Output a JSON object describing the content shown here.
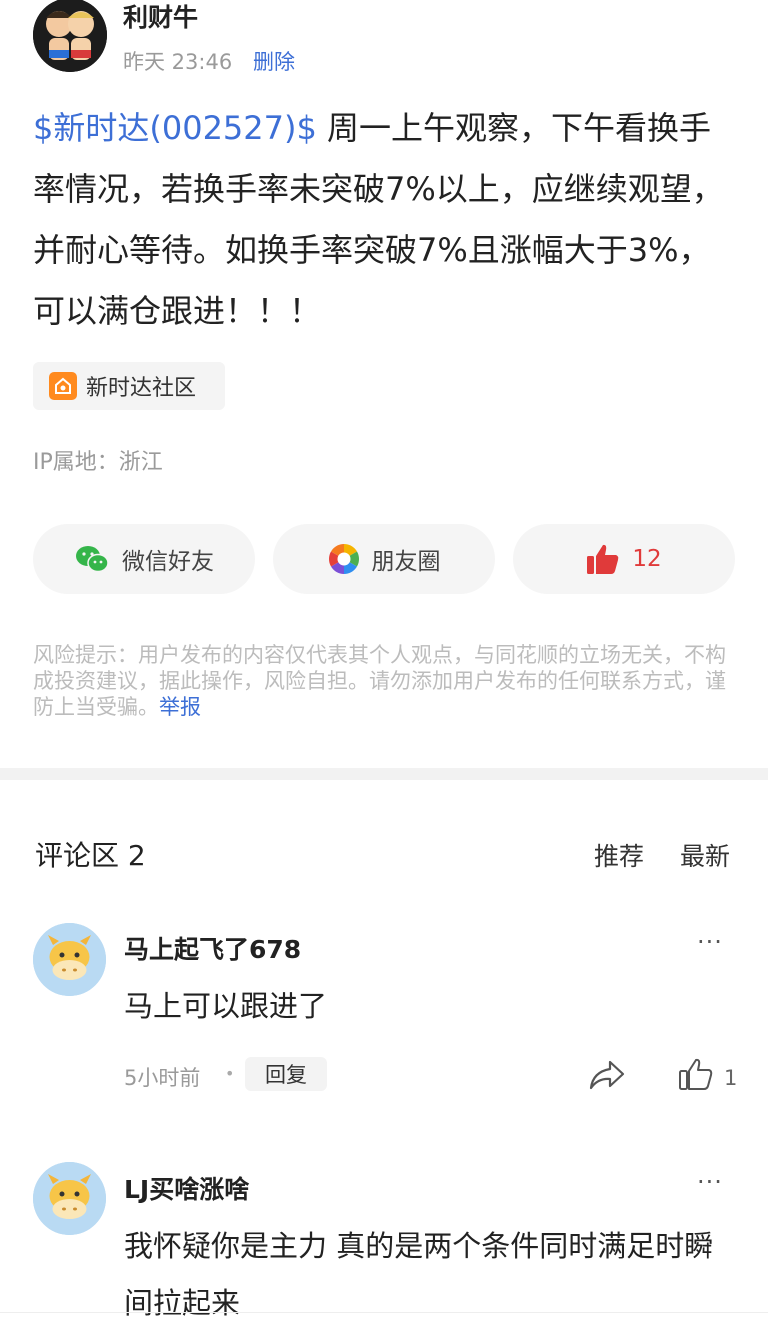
{
  "post": {
    "author": "利财牛",
    "time": "昨天 23:46",
    "delete_label": "删除",
    "stock_tag": "$新时达(002527)$",
    "body": " 周一上午观察，下午看换手率情况，若换手率未突破7%以上，应继续观望，并耐心等待。如换手率突破7%且涨幅大于3%，可以满仓跟进！！！",
    "community": "新时达社区",
    "ip_location": "IP属地：浙江"
  },
  "share": {
    "wechat_label": "微信好友",
    "moments_label": "朋友圈",
    "like_count": "12"
  },
  "risk": {
    "text": "风险提示：用户发布的内容仅代表其个人观点，与同花顺的立场无关，不构成投资建议，据此操作，风险自担。请勿添加用户发布的任何联系方式，谨防上当受骗。",
    "report_label": "举报"
  },
  "comments_header": {
    "title": "评论区 2",
    "sort_recommended": "推荐",
    "sort_latest": "最新"
  },
  "comments": [
    {
      "author": "马上起飞了678",
      "text": "马上可以跟进了",
      "time": "5小时前",
      "reply_label": "回复",
      "like_count": "1"
    },
    {
      "author": "LJ买啥涨啥",
      "text": "我怀疑你是主力 真的是两个条件同时满足时瞬间拉起来"
    }
  ],
  "icons": {
    "more": "···"
  },
  "colors": {
    "link_blue": "#3d6fd6",
    "like_red": "#e03a3a",
    "community_orange": "#ff8a1e"
  }
}
